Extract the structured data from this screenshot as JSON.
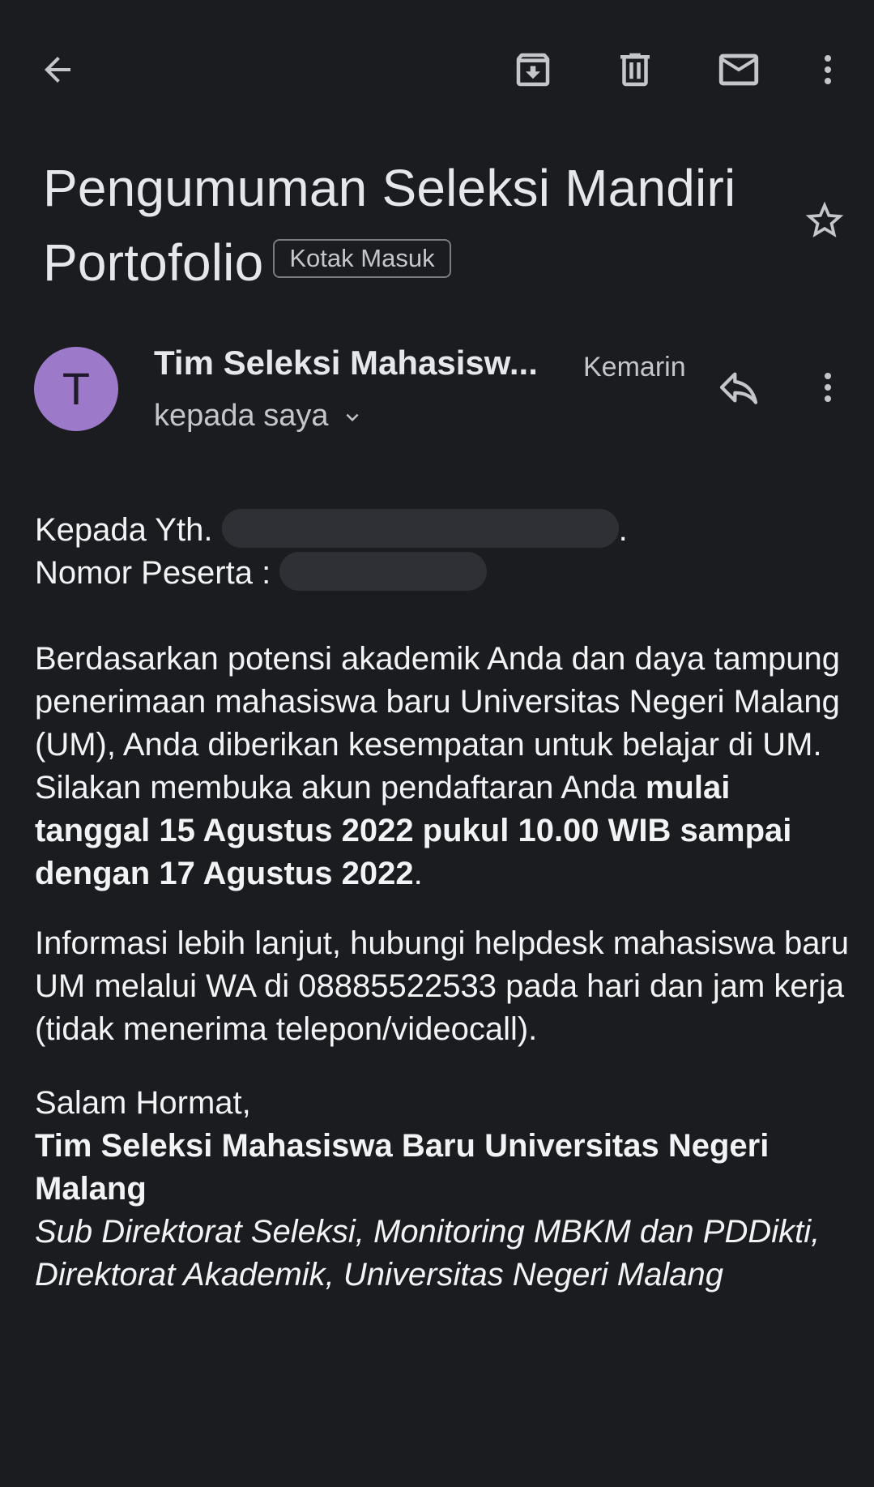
{
  "toolbar": {
    "back_icon": "arrow-left-icon",
    "archive_icon": "archive-icon",
    "delete_icon": "trash-icon",
    "mark_unread_icon": "mail-icon",
    "more_icon": "more-vert-icon"
  },
  "email": {
    "subject_line1": "Pengumuman Seleksi Mandiri",
    "subject_line2": "Portofolio",
    "label": "Kotak Masuk",
    "starred": false
  },
  "sender": {
    "avatar_letter": "T",
    "avatar_color": "#9c7ac9",
    "name": "Tim Seleksi Mahasisw...",
    "date": "Kemarin",
    "recipient": "kepada saya"
  },
  "body": {
    "greeting_prefix": "Kepada Yth.",
    "greeting_suffix": ".",
    "participant_label": "Nomor Peserta :",
    "p1_text": "Berdasarkan potensi akademik Anda dan daya tampung penerimaan mahasiswa baru Universitas Negeri Malang (UM), Anda diberikan kesempatan untuk belajar di UM. Silakan membuka akun pendaftaran Anda ",
    "p1_bold": "mulai tanggal 15 Agustus 2022 pukul 10.00 WIB sampai dengan 17 Agustus 2022",
    "p1_end": ".",
    "p2_text": "Informasi lebih lanjut, hubungi helpdesk mahasiswa baru UM melalui WA di 08885522533 pada hari dan jam kerja (tidak menerima telepon/videocall).",
    "closing": "Salam Hormat,",
    "signature_bold": "Tim Seleksi Mahasiswa Baru Universitas Negeri Malang",
    "signature_italic": "Sub Direktorat Seleksi, Monitoring MBKM dan PDDikti, Direktorat Akademik, Universitas Negeri Malang"
  },
  "colors": {
    "background": "#1b1c20",
    "text": "#f2f3f5",
    "muted": "#c4c6cb",
    "redaction": "#2e3036"
  }
}
